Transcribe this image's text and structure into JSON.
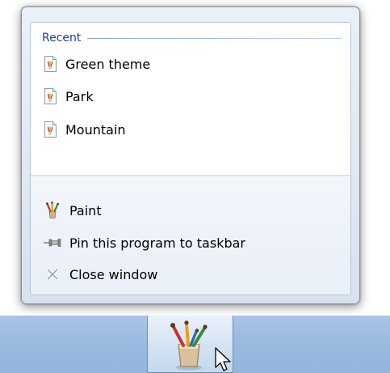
{
  "recent": {
    "title": "Recent",
    "items": [
      {
        "label": "Green theme",
        "icon": "paint-document-icon"
      },
      {
        "label": "Park",
        "icon": "paint-document-icon"
      },
      {
        "label": "Mountain",
        "icon": "paint-document-icon"
      }
    ]
  },
  "tasks": {
    "items": [
      {
        "label": "Paint",
        "icon": "paint-brushes-icon"
      },
      {
        "label": "Pin this program to taskbar",
        "icon": "pin-icon"
      },
      {
        "label": "Close window",
        "icon": "close-x-icon"
      }
    ]
  },
  "taskbar": {
    "active_app_icon": "paint-app-icon"
  },
  "colors": {
    "recent_header": "#1e3e9e",
    "taskbar": "#9cbbe1",
    "frame": "#dfe8f3"
  }
}
